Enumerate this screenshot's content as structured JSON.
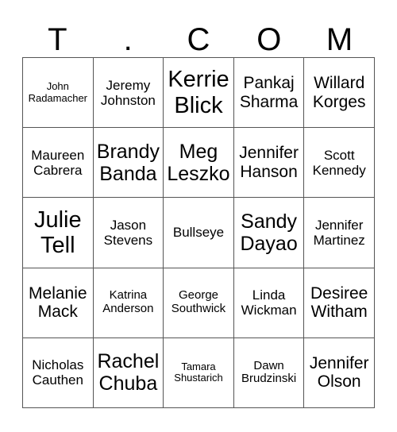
{
  "card": {
    "title_letters": [
      "T",
      ".",
      "C",
      "O",
      "M"
    ],
    "columns": 5,
    "rows": 5,
    "free_space_label": "Bullseye",
    "colors": {
      "background": "#ffffff",
      "text": "#000000",
      "grid_line": "#555555"
    },
    "cells": [
      [
        {
          "name": "John Radamacher",
          "size": "xs"
        },
        {
          "name": "Jeremy Johnston",
          "size": "m"
        },
        {
          "name": "Kerrie Blick",
          "size": "xxl"
        },
        {
          "name": "Pankaj Sharma",
          "size": "l"
        },
        {
          "name": "Willard Korges",
          "size": "l"
        }
      ],
      [
        {
          "name": "Maureen Cabrera",
          "size": "m"
        },
        {
          "name": "Brandy Banda",
          "size": "xl"
        },
        {
          "name": "Meg Leszko",
          "size": "xl"
        },
        {
          "name": "Jennifer Hanson",
          "size": "l"
        },
        {
          "name": "Scott Kennedy",
          "size": "m"
        }
      ],
      [
        {
          "name": "Julie Tell",
          "size": "xxl"
        },
        {
          "name": "Jason Stevens",
          "size": "m"
        },
        {
          "name": "Bullseye",
          "size": "m"
        },
        {
          "name": "Sandy Dayao",
          "size": "xl"
        },
        {
          "name": "Jennifer Martinez",
          "size": "m"
        }
      ],
      [
        {
          "name": "Melanie Mack",
          "size": "l"
        },
        {
          "name": "Katrina Anderson",
          "size": "s"
        },
        {
          "name": "George Southwick",
          "size": "s"
        },
        {
          "name": "Linda Wickman",
          "size": "m"
        },
        {
          "name": "Desiree Witham",
          "size": "l"
        }
      ],
      [
        {
          "name": "Nicholas Cauthen",
          "size": "m"
        },
        {
          "name": "Rachel Chuba",
          "size": "xl"
        },
        {
          "name": "Tamara Shustarich",
          "size": "xs"
        },
        {
          "name": "Dawn Brudzinski",
          "size": "s"
        },
        {
          "name": "Jennifer Olson",
          "size": "l"
        }
      ]
    ]
  }
}
